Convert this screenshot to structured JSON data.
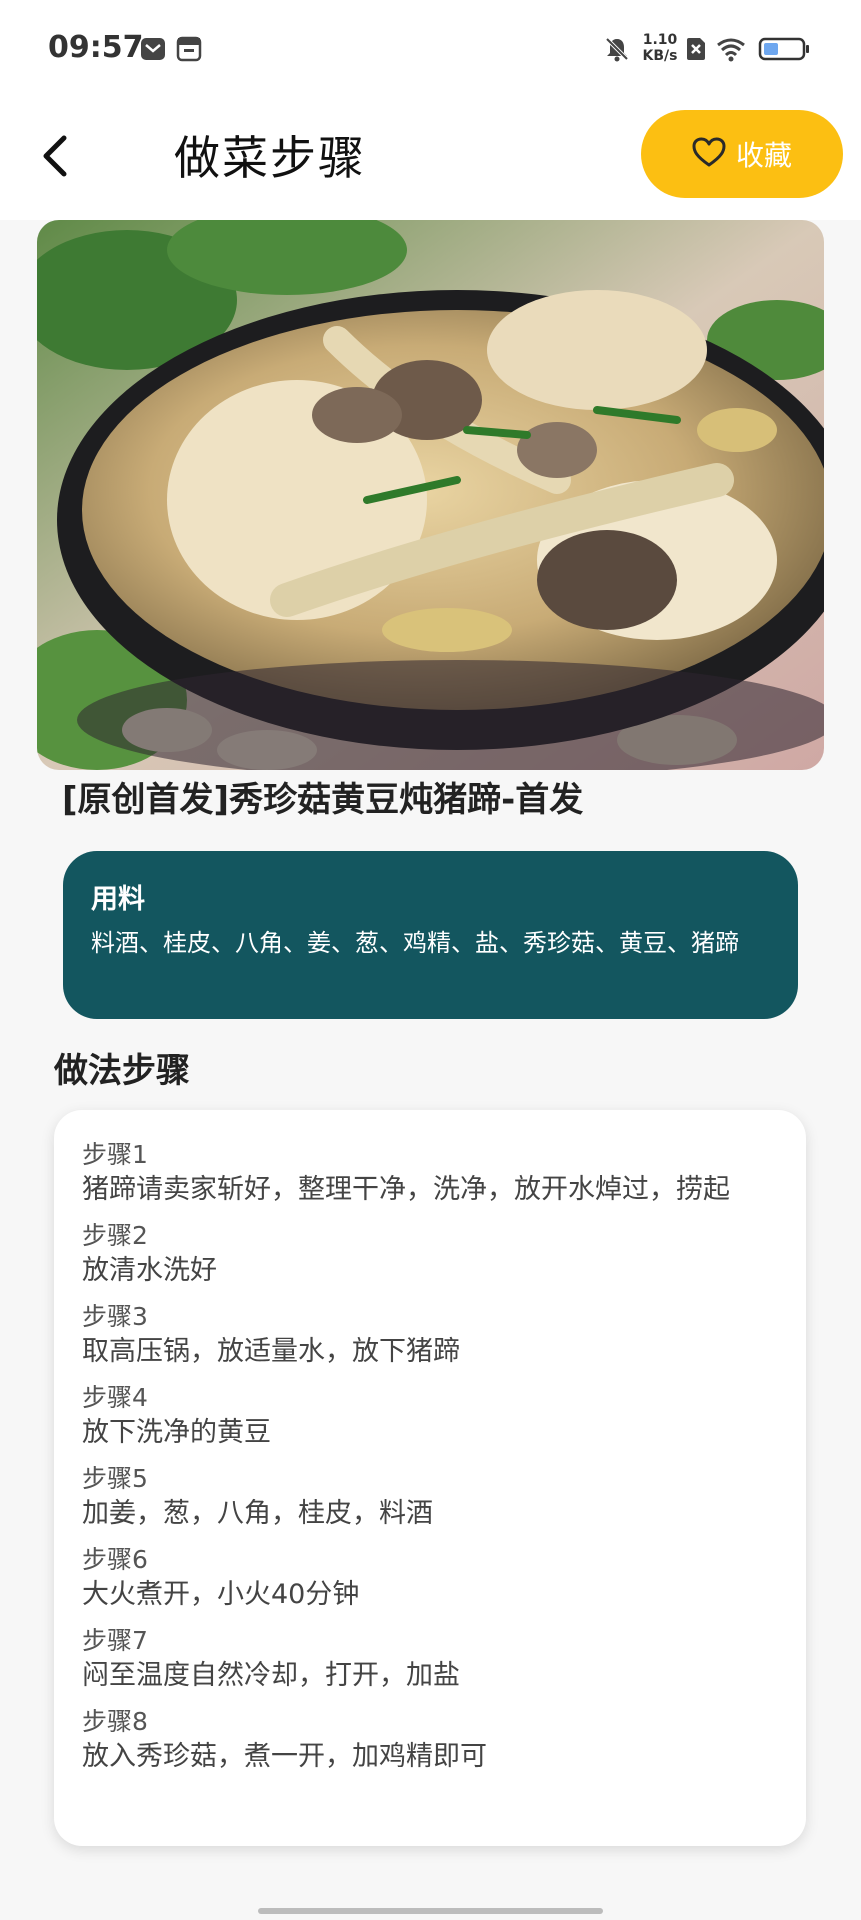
{
  "status_bar": {
    "time": "09:57",
    "net_speed_value": "1.10",
    "net_speed_unit": "KB/s",
    "icons": [
      "message-icon",
      "notification-box-icon",
      "mute-bell-icon",
      "sim-x-icon",
      "wifi-icon",
      "battery-icon"
    ]
  },
  "app_bar": {
    "title": "做菜步骤",
    "favorite_label": "收藏",
    "back_icon": "chevron-left-icon",
    "favorite_icon": "heart-outline-icon"
  },
  "colors": {
    "accent": "#fcbf12",
    "ingredients_card": "#13565f",
    "background": "#f7f7f7"
  },
  "recipe": {
    "title": "[原创首发]秀珍菇黄豆炖猪蹄-首发",
    "ingredients_heading": "用料",
    "ingredients": "料酒、桂皮、八角、姜、葱、鸡精、盐、秀珍菇、黄豆、猪蹄",
    "steps_heading": "做法步骤",
    "steps": [
      {
        "label": "步骤1",
        "text": "猪蹄请卖家斩好，整理干净，洗净，放开水焯过，捞起"
      },
      {
        "label": "步骤2",
        "text": "放清水洗好"
      },
      {
        "label": "步骤3",
        "text": "取高压锅，放适量水，放下猪蹄"
      },
      {
        "label": "步骤4",
        "text": "放下洗净的黄豆"
      },
      {
        "label": "步骤5",
        "text": "加姜，葱，八角，桂皮，料酒"
      },
      {
        "label": "步骤6",
        "text": "大火煮开，小火40分钟"
      },
      {
        "label": "步骤7",
        "text": "闷至温度自然冷却，打开，加盐"
      },
      {
        "label": "步骤8",
        "text": "放入秀珍菇，煮一开，加鸡精即可"
      }
    ]
  }
}
